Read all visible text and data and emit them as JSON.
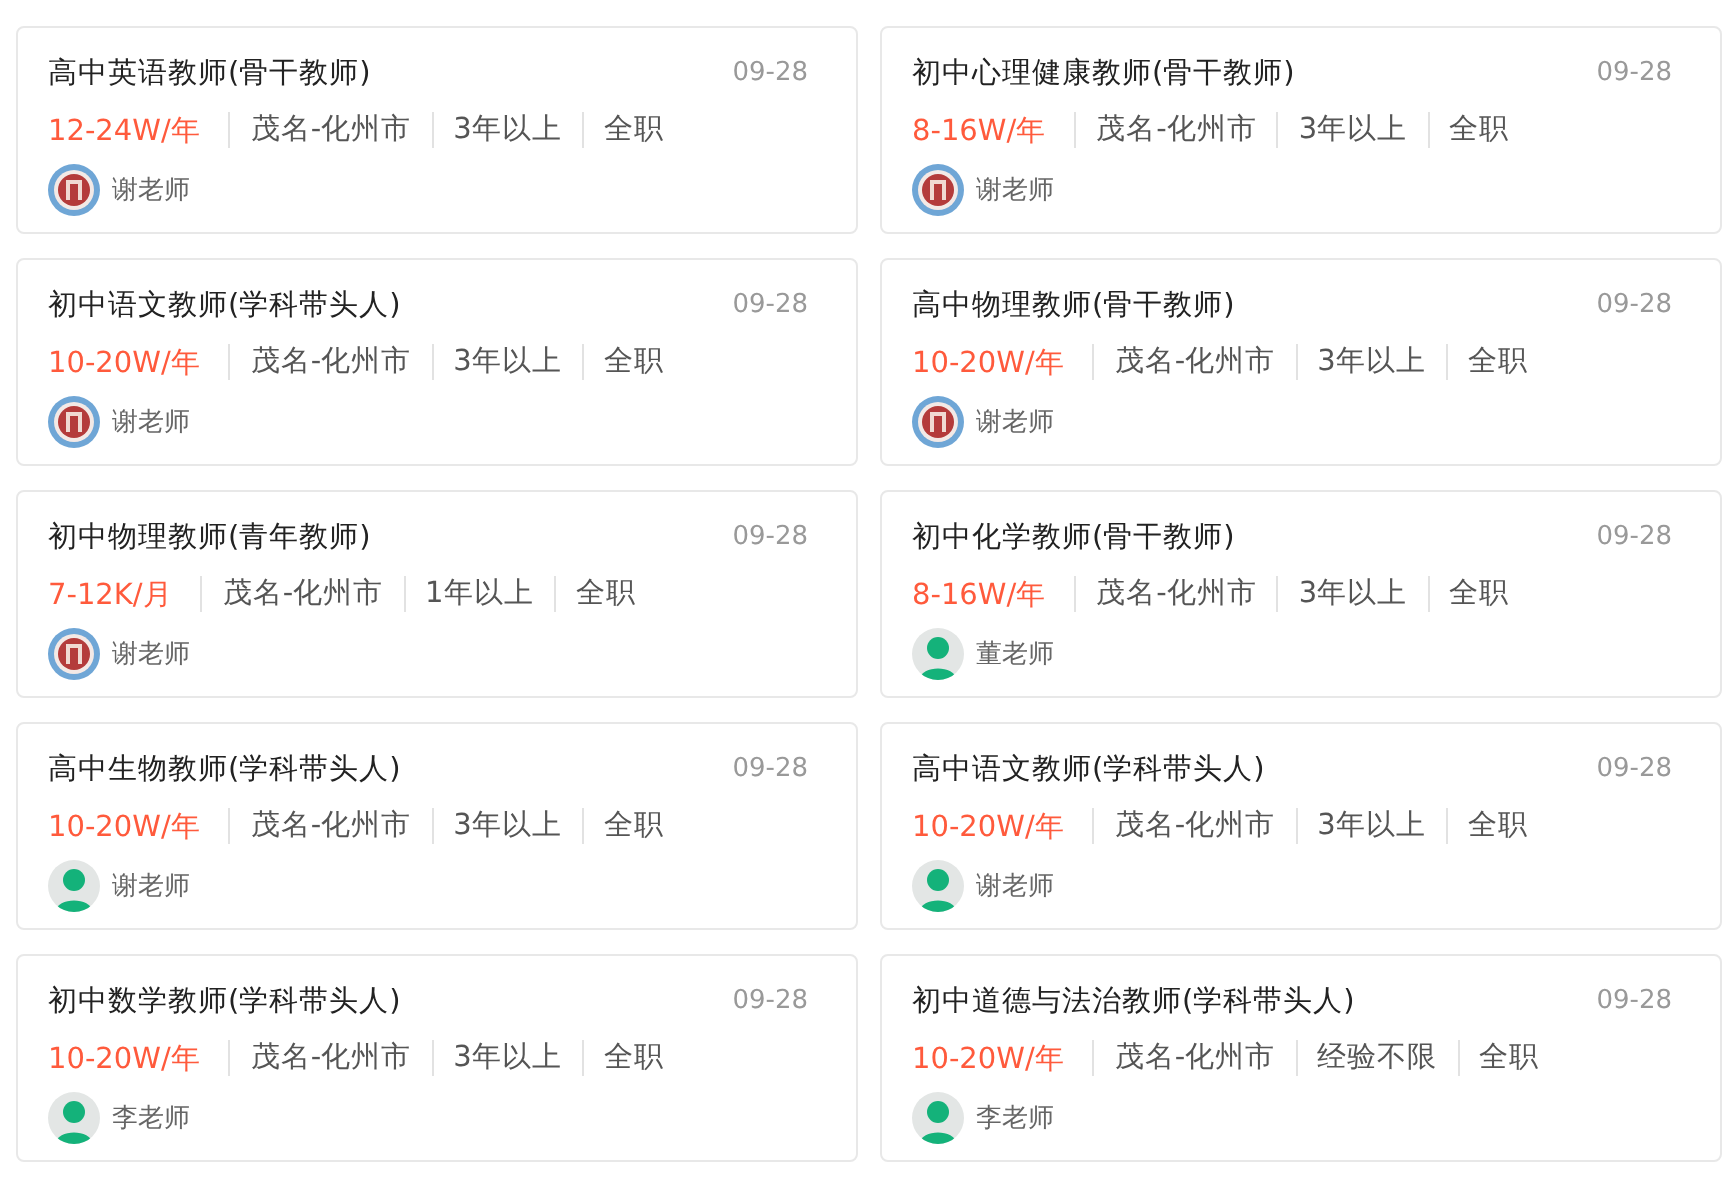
{
  "jobs": [
    {
      "title": "高中英语教师(骨干教师)",
      "date": "09-28",
      "salary": "12-24W/年",
      "tags": [
        "茂名-化州市",
        "3年以上",
        "全职"
      ],
      "contact": "谢老师",
      "avatar": {
        "kind": "emblem"
      }
    },
    {
      "title": "初中心理健康教师(骨干教师)",
      "date": "09-28",
      "salary": "8-16W/年",
      "tags": [
        "茂名-化州市",
        "3年以上",
        "全职"
      ],
      "contact": "谢老师",
      "avatar": {
        "kind": "emblem"
      }
    },
    {
      "title": "初中语文教师(学科带头人)",
      "date": "09-28",
      "salary": "10-20W/年",
      "tags": [
        "茂名-化州市",
        "3年以上",
        "全职"
      ],
      "contact": "谢老师",
      "avatar": {
        "kind": "emblem"
      }
    },
    {
      "title": "高中物理教师(骨干教师)",
      "date": "09-28",
      "salary": "10-20W/年",
      "tags": [
        "茂名-化州市",
        "3年以上",
        "全职"
      ],
      "contact": "谢老师",
      "avatar": {
        "kind": "emblem"
      }
    },
    {
      "title": "初中物理教师(青年教师)",
      "date": "09-28",
      "salary": "7-12K/月",
      "tags": [
        "茂名-化州市",
        "1年以上",
        "全职"
      ],
      "contact": "谢老师",
      "avatar": {
        "kind": "emblem"
      }
    },
    {
      "title": "初中化学教师(骨干教师)",
      "date": "09-28",
      "salary": "8-16W/年",
      "tags": [
        "茂名-化州市",
        "3年以上",
        "全职"
      ],
      "contact": "董老师",
      "avatar": {
        "kind": "person"
      }
    },
    {
      "title": "高中生物教师(学科带头人)",
      "date": "09-28",
      "salary": "10-20W/年",
      "tags": [
        "茂名-化州市",
        "3年以上",
        "全职"
      ],
      "contact": "谢老师",
      "avatar": {
        "kind": "person"
      }
    },
    {
      "title": "高中语文教师(学科带头人)",
      "date": "09-28",
      "salary": "10-20W/年",
      "tags": [
        "茂名-化州市",
        "3年以上",
        "全职"
      ],
      "contact": "谢老师",
      "avatar": {
        "kind": "person"
      }
    },
    {
      "title": "初中数学教师(学科带头人)",
      "date": "09-28",
      "salary": "10-20W/年",
      "tags": [
        "茂名-化州市",
        "3年以上",
        "全职"
      ],
      "contact": "李老师",
      "avatar": {
        "kind": "person"
      }
    },
    {
      "title": "初中道德与法治教师(学科带头人)",
      "date": "09-28",
      "salary": "10-20W/年",
      "tags": [
        "茂名-化州市",
        "经验不限",
        "全职"
      ],
      "contact": "李老师",
      "avatar": {
        "kind": "person"
      }
    }
  ]
}
